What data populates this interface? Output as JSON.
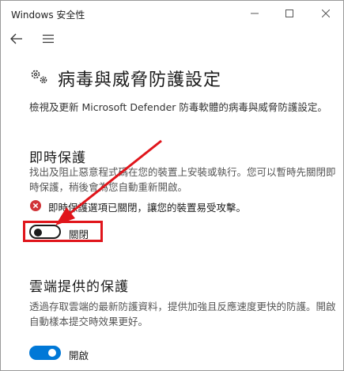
{
  "window": {
    "title": "Windows 安全性",
    "controls": {
      "minimize": "minimize-icon",
      "maximize": "maximize-icon",
      "close": "close-icon"
    }
  },
  "nav": {
    "back_icon": "back-arrow-icon",
    "menu_icon": "hamburger-menu-icon"
  },
  "page": {
    "icon": "gears-icon",
    "title": "病毒與威脅防護設定",
    "description": "檢視及更新 Microsoft Defender 防毒軟體的病毒與威脅防護設定。"
  },
  "realtime": {
    "heading": "即時保護",
    "description": "找出及阻止惡意程式碼在您的裝置上安裝或執行。您可以暫時先關閉即時保護，稍後會為您自動重新開啟。",
    "warning": "即時保護選項已關閉，讓您的裝置易受攻擊。",
    "warning_icon": "error-circle-icon",
    "toggle_label": "關閉",
    "toggle_on": false
  },
  "cloud": {
    "heading": "雲端提供的保護",
    "description": "透過存取雲端的最新防護資料，提供加強且反應速度更快的防護。開啟自動樣本提交時效果更好。",
    "toggle_label": "開啟",
    "toggle_on": true
  },
  "colors": {
    "accent": "#0078d7",
    "annotation_red": "#e0151b",
    "error_red": "#d13438"
  }
}
